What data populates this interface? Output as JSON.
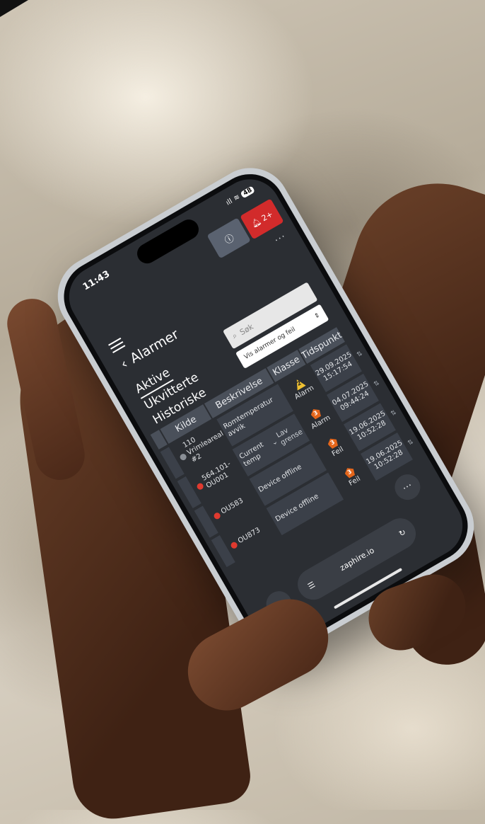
{
  "status_bar": {
    "time": "11:43",
    "signal": "ıll",
    "wifi": "≋",
    "battery": "48"
  },
  "header": {
    "alarm_count": "2+",
    "more": "···"
  },
  "page": {
    "back": "‹",
    "title": "Alarmer"
  },
  "tabs": [
    {
      "label": "Aktive",
      "active": true
    },
    {
      "label": "Ukvitterte",
      "active": false
    },
    {
      "label": "Historiske",
      "active": false
    }
  ],
  "search": {
    "placeholder": "Søk"
  },
  "filter": {
    "value": "Vis alarmer og feil"
  },
  "table": {
    "columns": [
      "Kilde",
      "Beskrivelse",
      "Klasse",
      "Tidspunkt"
    ],
    "sort_indicator": "⇅",
    "rows": [
      {
        "status_color": "#8a8f96",
        "kilde": "110 Vrimleareal #2",
        "beskrivelse": "Romtemperatur avvik",
        "level": "2",
        "level_type": "warn",
        "klasse": "Alarm",
        "date": "29.09.2025",
        "time": "15:17:54"
      },
      {
        "status_color": "#e03a2f",
        "kilde": "564.101-OU001",
        "beskrivelse": "Current temp",
        "limit": "Lav grense",
        "level": "3",
        "level_type": "fault",
        "klasse": "Alarm",
        "date": "04.07.2025",
        "time": "09:44:24"
      },
      {
        "status_color": "#e03a2f",
        "kilde": "OU583",
        "beskrivelse": "Device offline",
        "level": "3",
        "level_type": "fault",
        "klasse": "Feil",
        "date": "19.06.2025",
        "time": "10:52:28"
      },
      {
        "status_color": "#e03a2f",
        "kilde": "OU873",
        "beskrivelse": "Device offline",
        "level": "3",
        "level_type": "fault",
        "klasse": "Feil",
        "date": "19.06.2025",
        "time": "10:52:28"
      }
    ]
  },
  "browser": {
    "url": "zaphire.io",
    "reload": "↻",
    "back": "‹",
    "menu": "···"
  }
}
